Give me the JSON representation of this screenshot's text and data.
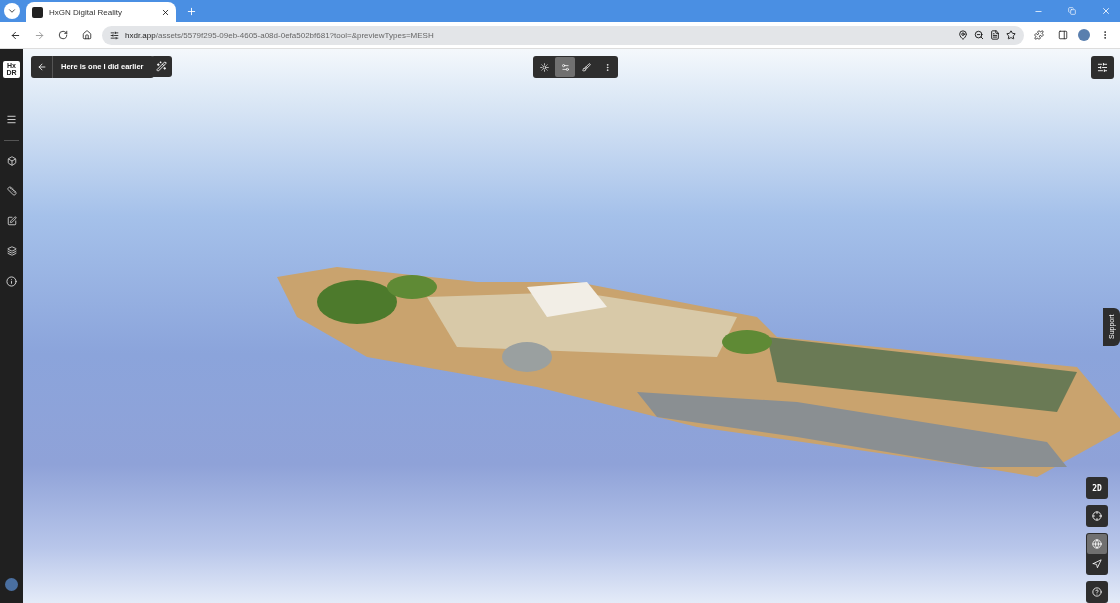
{
  "browser": {
    "tab_title": "HxGN Digital Reality",
    "url_host": "hxdr.app",
    "url_path": "/assets/5579f295-09eb-4605-a08d-0efa502bf681?tool=&previewTypes=MESH"
  },
  "sidebar": {
    "logo_top": "Hx",
    "logo_bottom": "DR"
  },
  "header": {
    "title": "Here is one I did earlier"
  },
  "view_modes": [
    {
      "kind": "points",
      "selected": false
    },
    {
      "kind": "mesh",
      "selected": true
    },
    {
      "kind": "paint",
      "selected": false
    }
  ],
  "map_controls": {
    "dimension_label": "2D",
    "navigation": [
      {
        "kind": "globe",
        "selected": true
      },
      {
        "kind": "navigate",
        "selected": false
      }
    ]
  },
  "support_tab": "Support"
}
